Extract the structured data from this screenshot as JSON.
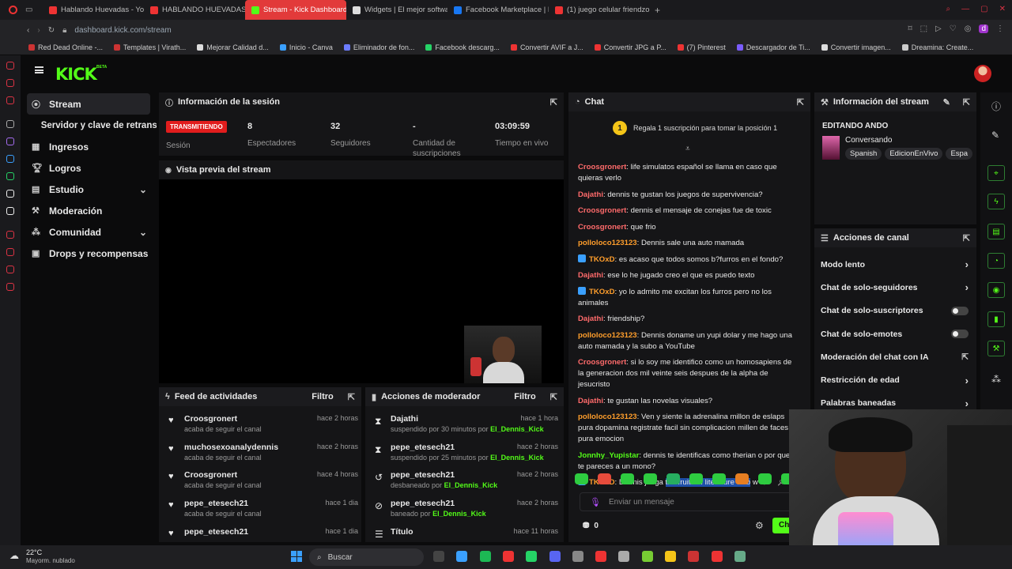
{
  "browser": {
    "tabs": [
      {
        "label": "Hablando Huevadas - You",
        "color": "#e33"
      },
      {
        "label": "HABLANDO HUEVADAS-",
        "color": "#e33"
      },
      {
        "label": "Stream - Kick Dashboard",
        "color": "#53fc18",
        "active": true
      },
      {
        "label": "Widgets | El mejor softwa",
        "color": "#ddd"
      },
      {
        "label": "Facebook Marketplace | F",
        "color": "#1877f2"
      },
      {
        "label": "(1) juego celular friendzon",
        "color": "#e33"
      }
    ],
    "url": "dashboard.kick.com/stream",
    "bookmarks": [
      "Red Dead Online -...",
      "Templates | Virath...",
      "Mejorar Calidad d...",
      "Inicio - Canva",
      "Eliminador de fon...",
      "Facebook descarg...",
      "Convertir AVIF a J...",
      "Convertir JPG a P...",
      "(7) Pinterest",
      "Descargador de Ti...",
      "Convertir imagen...",
      "Dreamina: Create..."
    ]
  },
  "kick": {
    "logo": "KICK",
    "beta": "BETA"
  },
  "nav": [
    {
      "label": "Stream",
      "icon": "broadcast-icon",
      "active": true
    },
    {
      "label": "Servidor y clave de retransm",
      "icon": "",
      "sub": true
    },
    {
      "label": "Ingresos",
      "icon": "money-icon"
    },
    {
      "label": "Logros",
      "icon": "trophy-icon"
    },
    {
      "label": "Estudio",
      "icon": "studio-icon",
      "chevron": true
    },
    {
      "label": "Moderación",
      "icon": "wrench-icon"
    },
    {
      "label": "Comunidad",
      "icon": "community-icon",
      "chevron": true
    },
    {
      "label": "Drops y recompensas",
      "icon": "drops-icon"
    }
  ],
  "session": {
    "title": "Información de la sesión",
    "live_badge": "TRANSMITIENDO",
    "live_label": "Sesión",
    "stats": [
      {
        "value": "8",
        "label": "Espectadores"
      },
      {
        "value": "32",
        "label": "Seguidores"
      },
      {
        "value": "-",
        "label": "Cantidad de suscripciones"
      },
      {
        "value": "03:09:59",
        "label": "Tiempo en vivo"
      }
    ]
  },
  "preview": {
    "title": "Vista previa del stream"
  },
  "feed": {
    "title": "Feed de actividades",
    "filter": "Filtro",
    "items": [
      {
        "name": "Croosgronert",
        "action": "acaba de seguir el canal",
        "time": "hace 2 horas"
      },
      {
        "name": "muchosexoanalydennis",
        "action": "acaba de seguir el canal",
        "time": "hace 2 horas"
      },
      {
        "name": "Croosgronert",
        "action": "acaba de seguir el canal",
        "time": "hace 4 horas"
      },
      {
        "name": "pepe_etesech21",
        "action": "acaba de seguir el canal",
        "time": "hace 1 dia"
      },
      {
        "name": "pepe_etesech21",
        "action": "",
        "time": "hace 1 dia"
      }
    ]
  },
  "mod": {
    "title": "Acciones de moderador",
    "filter": "Filtro",
    "items": [
      {
        "name": "Dajathi",
        "action": "suspendido por 30 minutos por",
        "by": "El_Dennis_Kick",
        "time": "hace 1 hora",
        "icon": "hourglass-icon"
      },
      {
        "name": "pepe_etesech21",
        "action": "suspendido por 25 minutos por",
        "by": "El_Dennis_Kick",
        "time": "hace 2 horas",
        "icon": "hourglass-icon"
      },
      {
        "name": "pepe_etesech21",
        "action": "desbaneado por",
        "by": "El_Dennis_Kick",
        "time": "hace 2 horas",
        "icon": "undo-icon"
      },
      {
        "name": "pepe_etesech21",
        "action": "baneado por",
        "by": "El_Dennis_Kick",
        "time": "hace 2 horas",
        "icon": "ban-icon"
      },
      {
        "name": "Título",
        "action": "",
        "by": "",
        "time": "hace 11 horas",
        "icon": "title-icon"
      }
    ]
  },
  "chat": {
    "title": "Chat",
    "gift_badge": "1",
    "gift_text": "Regala 1 suscripción para tomar la posición 1",
    "messages": [
      {
        "user": "Croosgronert",
        "color": "#ff6b6b",
        "text": "life simulatos español se llama en caso que quieras verlo"
      },
      {
        "user": "Dajathi",
        "color": "#ff6b6b",
        "text": "dennis te gustan los juegos de supervivencia?"
      },
      {
        "user": "Croosgronert",
        "color": "#ff6b6b",
        "text": "dennis el mensaje de conejas fue de toxic"
      },
      {
        "user": "Croosgronert",
        "color": "#ff6b6b",
        "text": "que frio"
      },
      {
        "user": "polloloco123123",
        "color": "#ff9e2c",
        "text": "Dennis sale una auto mamada"
      },
      {
        "user": "TKOxD",
        "color": "#ff9e2c",
        "text": "es acaso que todos somos b?furros en el fondo?",
        "badge": true
      },
      {
        "user": "Dajathi",
        "color": "#ff6b6b",
        "text": "ese lo he jugado creo el que es puedo texto"
      },
      {
        "user": "TKOxD",
        "color": "#ff9e2c",
        "text": "yo lo admito me excitan los furros pero no los animales",
        "badge": true
      },
      {
        "user": "Dajathi",
        "color": "#ff6b6b",
        "text": "friendship?"
      },
      {
        "user": "polloloco123123",
        "color": "#ff9e2c",
        "text": "Dennis doname un yupi dolar y me hago una auto mamada y la subo a YouTube"
      },
      {
        "user": "Croosgronert",
        "color": "#ff6b6b",
        "text": "si lo soy me identifico como un homosapiens de la generacion dos mil veinte seis despues de la alpha de jesucristo"
      },
      {
        "user": "Dajathi",
        "color": "#ff6b6b",
        "text": "te gustan las novelas visuales?"
      },
      {
        "user": "polloloco123123",
        "color": "#ff9e2c",
        "text": "Ven y siente la adrenalina millon de eslaps pura dopamina registrate facil sin complicacion millen de faces pura emocion"
      },
      {
        "user": "Jonnhy_Yupistar",
        "color": "#53fc18",
        "text": "dennis te identificas como therian o por que te pareces a un mono?"
      },
      {
        "user": "TKOxD",
        "color": "#ff9e2c",
        "text": "Dennis juega",
        "highlight": "the fruits of literature club",
        "tail": " w",
        "badge": true
      }
    ],
    "input_placeholder": "Enviar un mensaje",
    "points": "0",
    "send_label": "Chat"
  },
  "stream_info": {
    "title": "Información del stream",
    "editing": "EDITANDO ANDO",
    "category": "Conversando",
    "tags": [
      "Spanish",
      "EdicionEnVivo",
      "Espa"
    ]
  },
  "channel_actions": {
    "title": "Acciones de canal",
    "items": [
      {
        "label": "Modo lento",
        "control": "chevron"
      },
      {
        "label": "Chat de solo-seguidores",
        "control": "chevron"
      },
      {
        "label": "Chat de solo-suscriptores",
        "control": "toggle"
      },
      {
        "label": "Chat de solo-emotes",
        "control": "toggle"
      },
      {
        "label": "Moderación del chat con IA",
        "control": "external"
      },
      {
        "label": "Restricción de edad",
        "control": "chevron"
      },
      {
        "label": "Palabras baneadas",
        "control": "chevron"
      }
    ]
  },
  "taskbar": {
    "weather_temp": "22°C",
    "weather_desc": "Mayorm. nublado",
    "search": "Buscar"
  }
}
